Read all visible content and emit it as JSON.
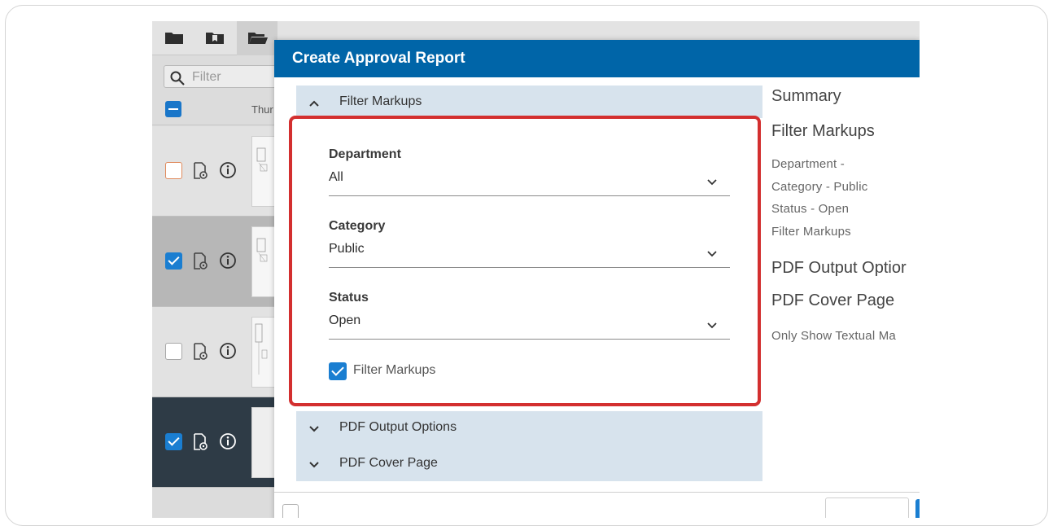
{
  "modal": {
    "title": "Create Approval Report"
  },
  "sidebar": {
    "filter_placeholder": "Filter",
    "thumbnail_column_label": "Thur",
    "rows": [
      {
        "checked": false,
        "color": "#e08a5c"
      },
      {
        "checked": true
      },
      {
        "checked": false
      },
      {
        "checked": true
      }
    ]
  },
  "sections": {
    "filter_markups": {
      "label": "Filter Markups",
      "expanded": true,
      "fields": {
        "department": {
          "label": "Department",
          "value": "All"
        },
        "category": {
          "label": "Category",
          "value": "Public"
        },
        "status": {
          "label": "Status",
          "value": "Open"
        }
      },
      "checkbox": {
        "label": "Filter Markups",
        "checked": true
      }
    },
    "pdf_output": {
      "label": "PDF Output Options",
      "expanded": false
    },
    "pdf_cover": {
      "label": "PDF Cover Page",
      "expanded": false
    }
  },
  "summary": {
    "title": "Summary",
    "filter_heading": "Filter Markups",
    "lines": [
      "Department -",
      "Category - Public",
      "Status - Open",
      "Filter Markups"
    ],
    "pdf_output_heading": "PDF Output Optior",
    "pdf_cover_heading": "PDF Cover Page",
    "cover_line": "Only Show Textual Ma"
  },
  "colors": {
    "header": "#0065a8",
    "accent": "#1a7ed1",
    "highlight": "#d32f2f"
  }
}
